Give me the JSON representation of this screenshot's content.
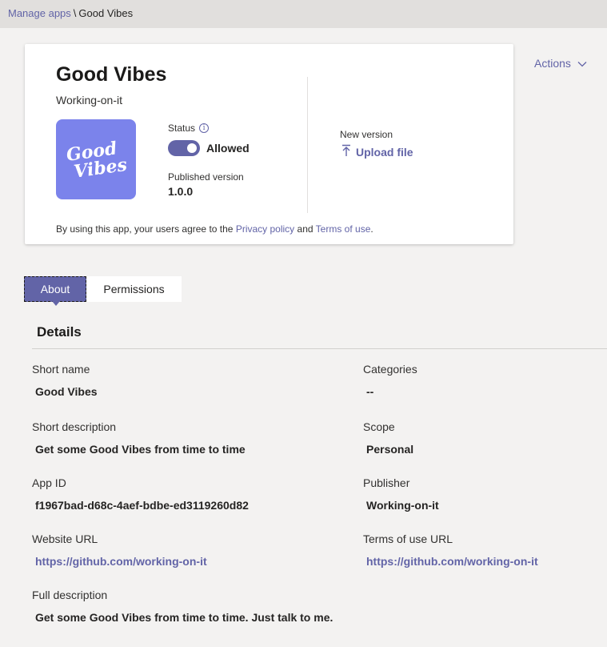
{
  "breadcrumb": {
    "parent": "Manage apps",
    "separator": "\\",
    "current": "Good Vibes"
  },
  "app": {
    "name": "Good Vibes",
    "developer": "Working-on-it",
    "icon_line1": "Good",
    "icon_line2": "Vibes",
    "icon_color": "#7b83eb"
  },
  "status": {
    "label": "Status",
    "info_icon": "i",
    "toggle_text": "Allowed",
    "enabled": true
  },
  "published": {
    "label": "Published version",
    "value": "1.0.0"
  },
  "new_version": {
    "label": "New version",
    "upload_label": "Upload file"
  },
  "agreement": {
    "prefix": "By using this app, your users agree to the",
    "privacy_link": "Privacy policy",
    "and": "and",
    "terms_link": "Terms of use",
    "suffix": "."
  },
  "actions_label": "Actions",
  "tabs": [
    {
      "label": "About",
      "selected": true
    },
    {
      "label": "Permissions",
      "selected": false
    }
  ],
  "details": {
    "title": "Details",
    "short_name": {
      "label": "Short name",
      "value": "Good Vibes"
    },
    "categories": {
      "label": "Categories",
      "value": "--"
    },
    "short_description": {
      "label": "Short description",
      "value": "Get some Good Vibes from time to time"
    },
    "scope": {
      "label": "Scope",
      "value": "Personal"
    },
    "app_id": {
      "label": "App ID",
      "value": "f1967bad-d68c-4aef-bdbe-ed3119260d82"
    },
    "publisher": {
      "label": "Publisher",
      "value": "Working-on-it"
    },
    "website_url": {
      "label": "Website URL",
      "value": "https://github.com/working-on-it"
    },
    "terms_url": {
      "label": "Terms of use URL",
      "value": "https://github.com/working-on-it"
    },
    "full_description": {
      "label": "Full description",
      "value": "Get some Good Vibes from time to time. Just talk to me."
    }
  },
  "colors": {
    "accent": "#6264a7",
    "background": "#f3f2f1",
    "topbar": "#e1dfdd"
  }
}
